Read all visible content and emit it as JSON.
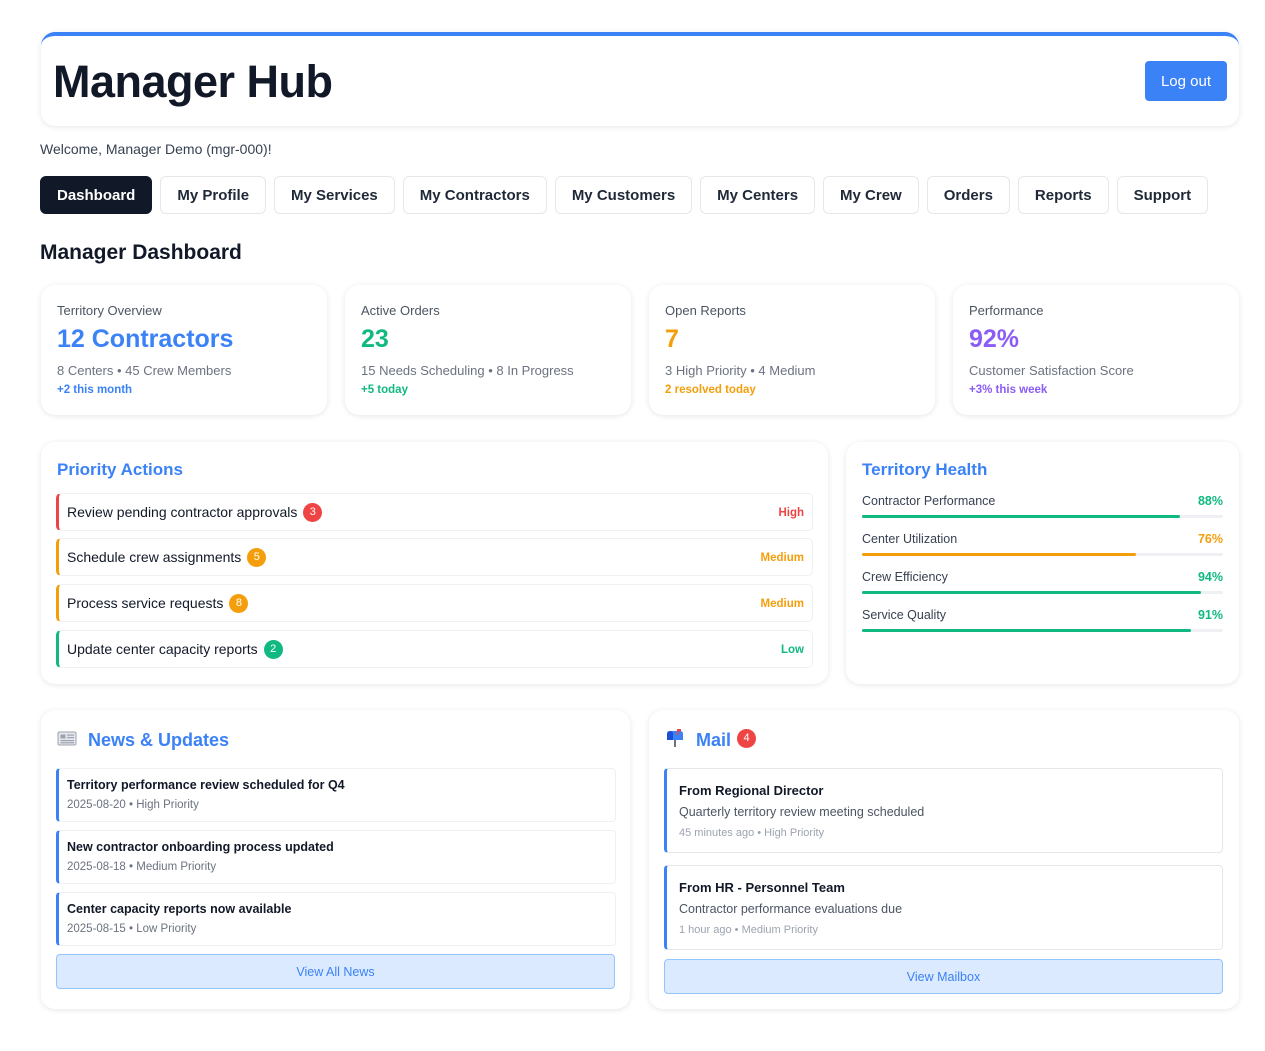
{
  "header": {
    "title": "Manager Hub",
    "logout_label": "Log out"
  },
  "welcome": "Welcome, Manager Demo (mgr-000)!",
  "nav": [
    "Dashboard",
    "My Profile",
    "My Services",
    "My Contractors",
    "My Customers",
    "My Centers",
    "My Crew",
    "Orders",
    "Reports",
    "Support"
  ],
  "nav_active": "Dashboard",
  "dashboard_title": "Manager Dashboard",
  "stats": [
    {
      "label": "Territory Overview",
      "value": "12 Contractors",
      "sub": "8 Centers • 45 Crew Members",
      "change": "+2 this month",
      "color": "#3b82f6"
    },
    {
      "label": "Active Orders",
      "value": "23",
      "sub": "15 Needs Scheduling • 8 In Progress",
      "change": "+5 today",
      "color": "#10b981"
    },
    {
      "label": "Open Reports",
      "value": "7",
      "sub": "3 High Priority • 4 Medium",
      "change": "2 resolved today",
      "color": "#f59e0b"
    },
    {
      "label": "Performance",
      "value": "92%",
      "sub": "Customer Satisfaction Score",
      "change": "+3% this week",
      "color": "#8b5cf6"
    }
  ],
  "priority_actions": {
    "title": "Priority Actions",
    "items": [
      {
        "text": "Review pending contractor approvals",
        "count": "3",
        "priority": "High",
        "color": "#ef4444"
      },
      {
        "text": "Schedule crew assignments",
        "count": "5",
        "priority": "Medium",
        "color": "#f59e0b"
      },
      {
        "text": "Process service requests",
        "count": "8",
        "priority": "Medium",
        "color": "#f59e0b"
      },
      {
        "text": "Update center capacity reports",
        "count": "2",
        "priority": "Low",
        "color": "#10b981"
      }
    ]
  },
  "territory_health": {
    "title": "Territory Health",
    "metrics": [
      {
        "label": "Contractor Performance",
        "percent": "88%",
        "value": 88,
        "color": "#10b981"
      },
      {
        "label": "Center Utilization",
        "percent": "76%",
        "value": 76,
        "color": "#f59e0b"
      },
      {
        "label": "Crew Efficiency",
        "percent": "94%",
        "value": 94,
        "color": "#10b981"
      },
      {
        "label": "Service Quality",
        "percent": "91%",
        "value": 91,
        "color": "#10b981"
      }
    ]
  },
  "news": {
    "title": "News & Updates",
    "icon": "newspaper-icon",
    "items": [
      {
        "title": "Territory performance review scheduled for Q4",
        "meta": "2025-08-20 • High Priority"
      },
      {
        "title": "New contractor onboarding process updated",
        "meta": "2025-08-18 • Medium Priority"
      },
      {
        "title": "Center capacity reports now available",
        "meta": "2025-08-15 • Low Priority"
      }
    ],
    "button": "View All News"
  },
  "mail": {
    "title": "Mail",
    "icon": "mailbox-icon",
    "count": "4",
    "items": [
      {
        "from": "From Regional Director",
        "subject": "Quarterly territory review meeting scheduled",
        "meta": "45 minutes ago • High Priority"
      },
      {
        "from": "From HR - Personnel Team",
        "subject": "Contractor performance evaluations due",
        "meta": "1 hour ago • Medium Priority"
      }
    ],
    "button": "View Mailbox"
  }
}
